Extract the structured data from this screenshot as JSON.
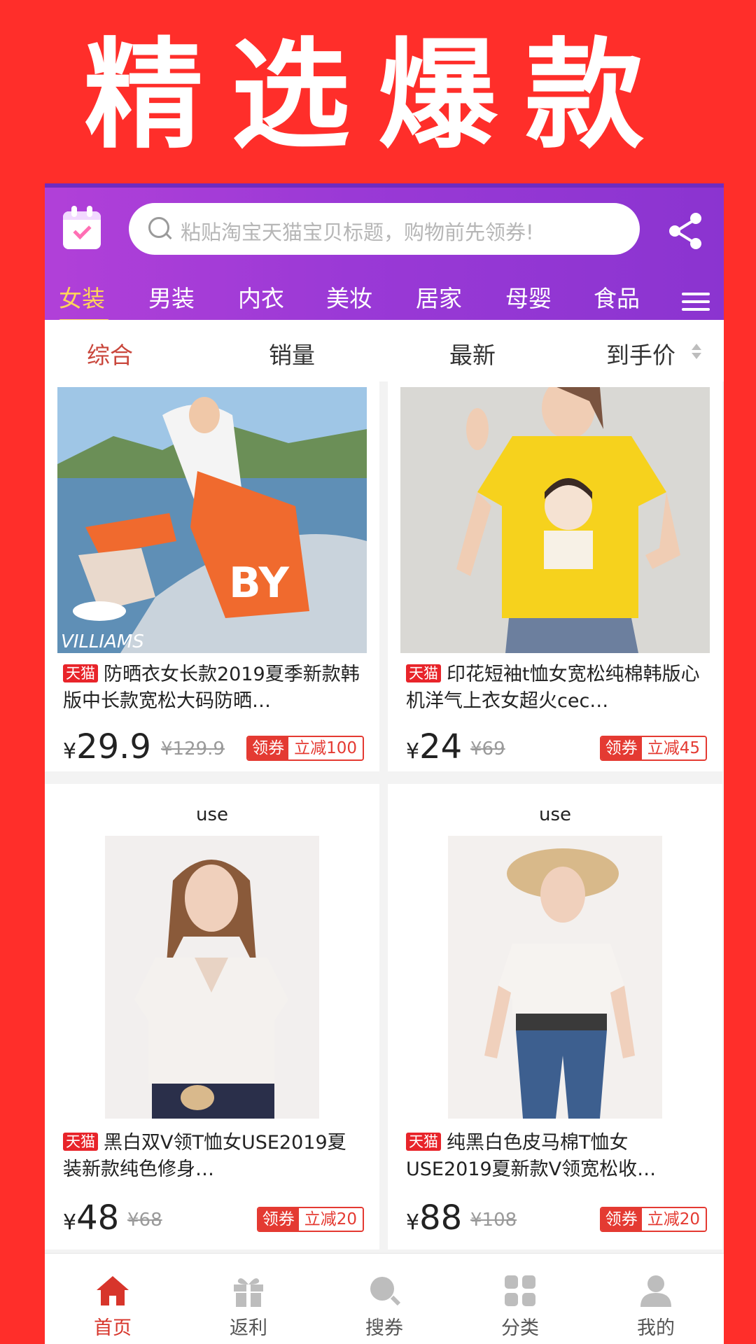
{
  "promo": {
    "title": "精选爆款"
  },
  "search": {
    "placeholder": "粘贴淘宝天猫宝贝标题，购物前先领券!"
  },
  "icons": {
    "calendar": "calendar-icon",
    "share": "share-icon",
    "menu": "menu-icon",
    "search": "search-icon"
  },
  "categories": [
    {
      "label": "女装",
      "active": true
    },
    {
      "label": "男装"
    },
    {
      "label": "内衣"
    },
    {
      "label": "美妆"
    },
    {
      "label": "居家"
    },
    {
      "label": "母婴"
    },
    {
      "label": "食品"
    }
  ],
  "sort": [
    {
      "label": "综合",
      "active": true
    },
    {
      "label": "销量"
    },
    {
      "label": "最新"
    },
    {
      "label": "到手价"
    }
  ],
  "products": [
    {
      "badge": "天猫",
      "title": "防晒衣女长款2019夏季新款韩版中长款宽松大码防晒…",
      "currency": "¥",
      "price": "29.9",
      "original": "¥129.9",
      "coupon_label": "领券",
      "coupon_value": "立减100"
    },
    {
      "badge": "天猫",
      "title": "印花短袖t恤女宽松纯棉韩版心机洋气上衣女超火cec…",
      "currency": "¥",
      "price": "24",
      "original": "¥69",
      "coupon_label": "领券",
      "coupon_value": "立减45"
    },
    {
      "badge": "天猫",
      "title": "黑白双V领T恤女USE2019夏装新款纯色修身…",
      "currency": "¥",
      "price": "48",
      "original": "¥68",
      "coupon_label": "领券",
      "coupon_value": "立减20",
      "brand_mark": "use"
    },
    {
      "badge": "天猫",
      "title": "纯黑白色皮马棉T恤女USE2019夏新款V领宽松收…",
      "currency": "¥",
      "price": "88",
      "original": "¥108",
      "coupon_label": "领券",
      "coupon_value": "立减20",
      "brand_mark": "use"
    }
  ],
  "bottom_nav": [
    {
      "label": "首页",
      "icon": "home-icon",
      "active": true
    },
    {
      "label": "返利",
      "icon": "gift-icon"
    },
    {
      "label": "搜券",
      "icon": "search-icon"
    },
    {
      "label": "分类",
      "icon": "grid-icon"
    },
    {
      "label": "我的",
      "icon": "user-icon"
    }
  ],
  "colors": {
    "background": "#ff2e2a",
    "header_gradient_start": "#b140d8",
    "header_gradient_end": "#8b34d0",
    "active_tab": "#ffd45a",
    "accent_red": "#d7352b"
  }
}
